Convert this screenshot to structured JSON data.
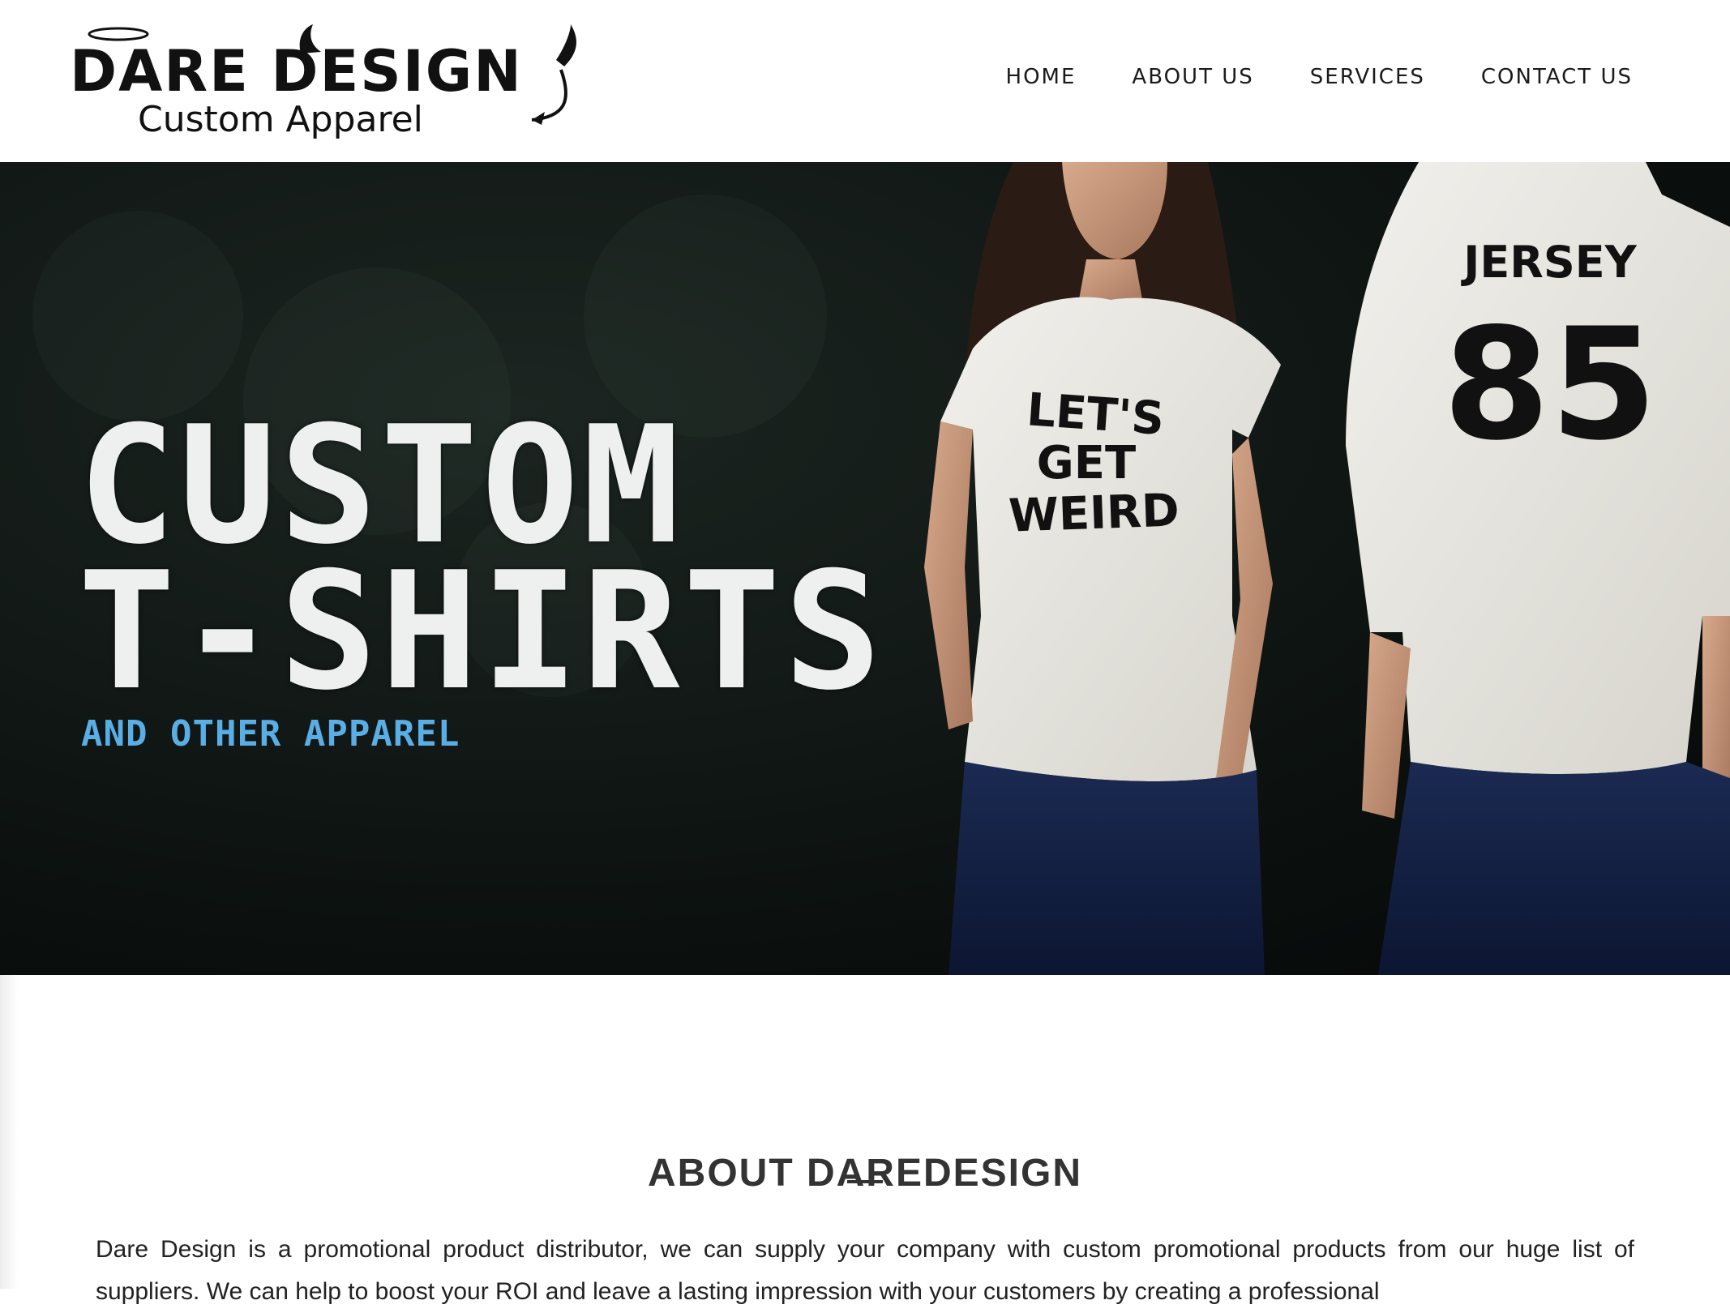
{
  "header": {
    "logo": {
      "line1": "DARE DESIGN",
      "line2": "Custom Apparel"
    },
    "nav": [
      {
        "label": "HOME"
      },
      {
        "label": "ABOUT US"
      },
      {
        "label": "SERVICES"
      },
      {
        "label": "CONTACT US"
      }
    ]
  },
  "hero": {
    "title_line1": "CUSTOM",
    "title_line2": "T-SHIRTS",
    "subtitle": "AND OTHER APPAREL",
    "shirt_front_text": [
      "LET'S",
      "GET",
      "WEIRD"
    ],
    "shirt_back_name": "JERSEY",
    "shirt_back_number": "85"
  },
  "about": {
    "title": "ABOUT DAREDESIGN",
    "text": "Dare Design is a promotional product distributor, we can supply your company with custom promotional products from our huge list of suppliers. We can help to boost your ROI and leave a lasting impression with your customers by creating a professional"
  },
  "colors": {
    "accent_blue": "#5aaee6",
    "hero_dark": "#0e1412",
    "nav_text": "#1a1a1a"
  }
}
